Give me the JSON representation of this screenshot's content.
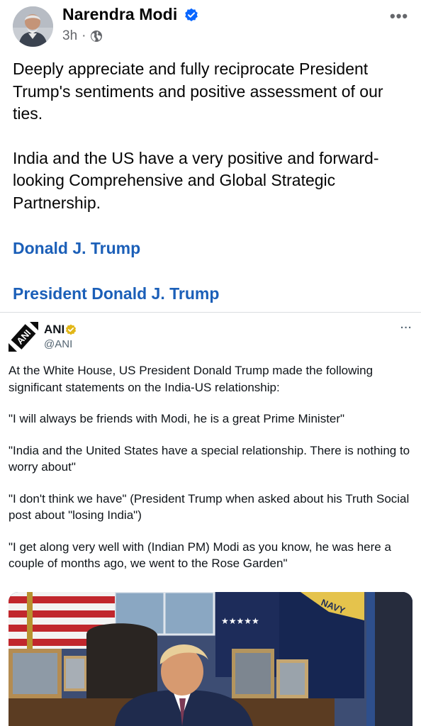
{
  "post": {
    "author": "Narendra Modi",
    "time": "3h",
    "separator": "·",
    "more": "•••",
    "paragraphs": [
      "Deeply appreciate and fully reciprocate President Trump's sentiments and positive assessment of our ties.",
      "India and the US have a very positive and forward-looking Comprehensive and Global Strategic Partnership."
    ],
    "links": [
      "Donald J. Trump",
      "President Donald J. Trump"
    ]
  },
  "embed": {
    "name": "ANI",
    "handle": "@ANI",
    "more": "···",
    "paragraphs": [
      "At the White House, US President Donald Trump made the following significant statements on the India-US relationship:",
      "\"I will always be friends with Modi, he is a great Prime Minister\"",
      "\"India and the United States have a special relationship. There is nothing to worry about\"",
      "\"I don't think we have\" (President Trump when asked about his Truth Social post about \"losing India\")",
      "\"I get along very well with (Indian PM) Modi as you know, he was here a couple of months ago, we went to the Rose Garden\""
    ],
    "photo_flag_text": "NAVY"
  },
  "colors": {
    "link": "#1b5fb8",
    "verified_fb": "#0866ff",
    "verified_x": "#e2b719"
  }
}
